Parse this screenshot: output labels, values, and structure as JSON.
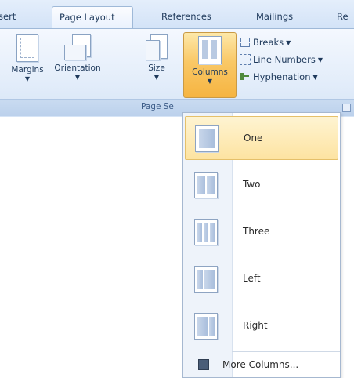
{
  "tabs": [
    {
      "label": "sert"
    },
    {
      "label": "Page Layout",
      "active": true
    },
    {
      "label": "References"
    },
    {
      "label": "Mailings"
    },
    {
      "label": "Re"
    }
  ],
  "ribbon": {
    "group_label": "Page Se",
    "buttons": [
      {
        "label": "Margins",
        "icon": "margins-icon"
      },
      {
        "label": "Orientation",
        "icon": "orientation-icon"
      },
      {
        "label": "Size",
        "icon": "size-icon"
      },
      {
        "label": "Columns",
        "icon": "columns-icon",
        "pressed": true
      }
    ],
    "small_buttons": [
      {
        "label": "Breaks",
        "icon": "breaks-icon"
      },
      {
        "label": "Line Numbers",
        "icon": "line-numbers-icon"
      },
      {
        "label": "Hyphenation",
        "icon": "hyphenation-icon"
      }
    ]
  },
  "columns_menu": {
    "options": [
      {
        "label": "One",
        "selected": true
      },
      {
        "label": "Two"
      },
      {
        "label": "Three"
      },
      {
        "label": "Left"
      },
      {
        "label": "Right"
      }
    ],
    "more": {
      "prefix": "More ",
      "accel": "C",
      "suffix": "olumns..."
    }
  },
  "colors": {
    "ribbon_bg": "#e3edfa",
    "selected_highlight": "#f9c866",
    "text": "#1e395b"
  }
}
